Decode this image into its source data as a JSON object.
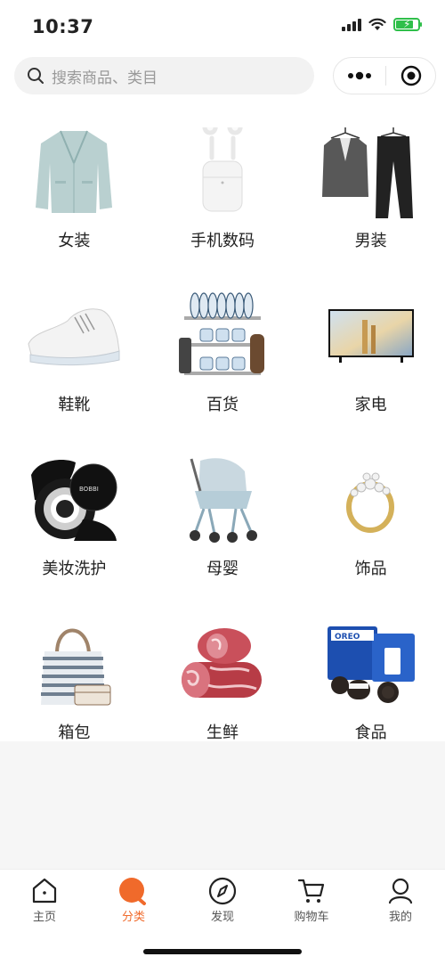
{
  "status": {
    "time": "10:37"
  },
  "search": {
    "placeholder": "搜索商品、类目"
  },
  "categories": [
    {
      "label": "女装",
      "icon": "blazer-image"
    },
    {
      "label": "手机数码",
      "icon": "earbuds-image"
    },
    {
      "label": "男装",
      "icon": "suit-image"
    },
    {
      "label": "鞋靴",
      "icon": "sneaker-image"
    },
    {
      "label": "百货",
      "icon": "dish-rack-image"
    },
    {
      "label": "家电",
      "icon": "tv-image"
    },
    {
      "label": "美妆洗护",
      "icon": "cosmetic-jar-image"
    },
    {
      "label": "母婴",
      "icon": "stroller-image"
    },
    {
      "label": "饰品",
      "icon": "ring-image"
    },
    {
      "label": "箱包",
      "icon": "tote-bag-image"
    },
    {
      "label": "生鲜",
      "icon": "meat-roll-image"
    },
    {
      "label": "食品",
      "icon": "cookies-image"
    }
  ],
  "tabbar": {
    "items": [
      {
        "label": "主页",
        "icon": "home-icon"
      },
      {
        "label": "分类",
        "icon": "category-icon",
        "active": true
      },
      {
        "label": "发现",
        "icon": "compass-icon"
      },
      {
        "label": "购物车",
        "icon": "cart-icon"
      },
      {
        "label": "我的",
        "icon": "profile-icon"
      }
    ]
  },
  "colors": {
    "accent": "#f06a2b",
    "battery": "#2fbf4a"
  }
}
